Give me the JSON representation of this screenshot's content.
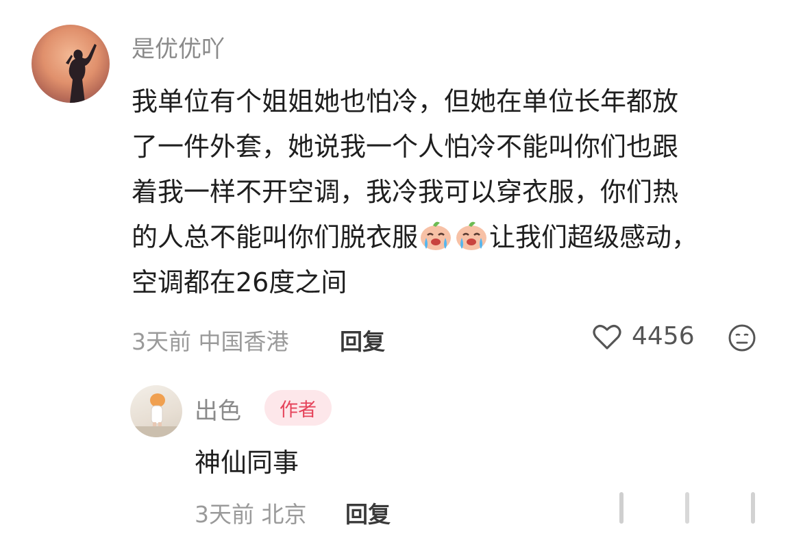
{
  "main_comment": {
    "username": "是优优吖",
    "lines": [
      "我单位有个姐姐她也怕冷，但她在单位长年都放",
      "了一件外套，她说我一个人怕冷不能叫你们也跟",
      "着我一样不开空调，我冷我可以穿衣服，你们热",
      "的人总不能叫你们脱衣服",
      "让我们超级感动，",
      "空调都在26度之间"
    ],
    "time": "3天前",
    "location": "中国香港",
    "reply_label": "回复",
    "like_count": "4456",
    "icons": {
      "like": "heart-outline-icon",
      "dislike": "meh-face-icon",
      "emoji": "crying-peach-emoji-icon"
    }
  },
  "reply_comment": {
    "username": "出色",
    "author_badge": "作者",
    "text": "神仙同事",
    "time": "3天前",
    "location": "北京",
    "reply_label": "回复"
  },
  "colors": {
    "badge_bg": "#fde7ea",
    "badge_text": "#e5435a",
    "meta_text": "#9a9a9a"
  }
}
